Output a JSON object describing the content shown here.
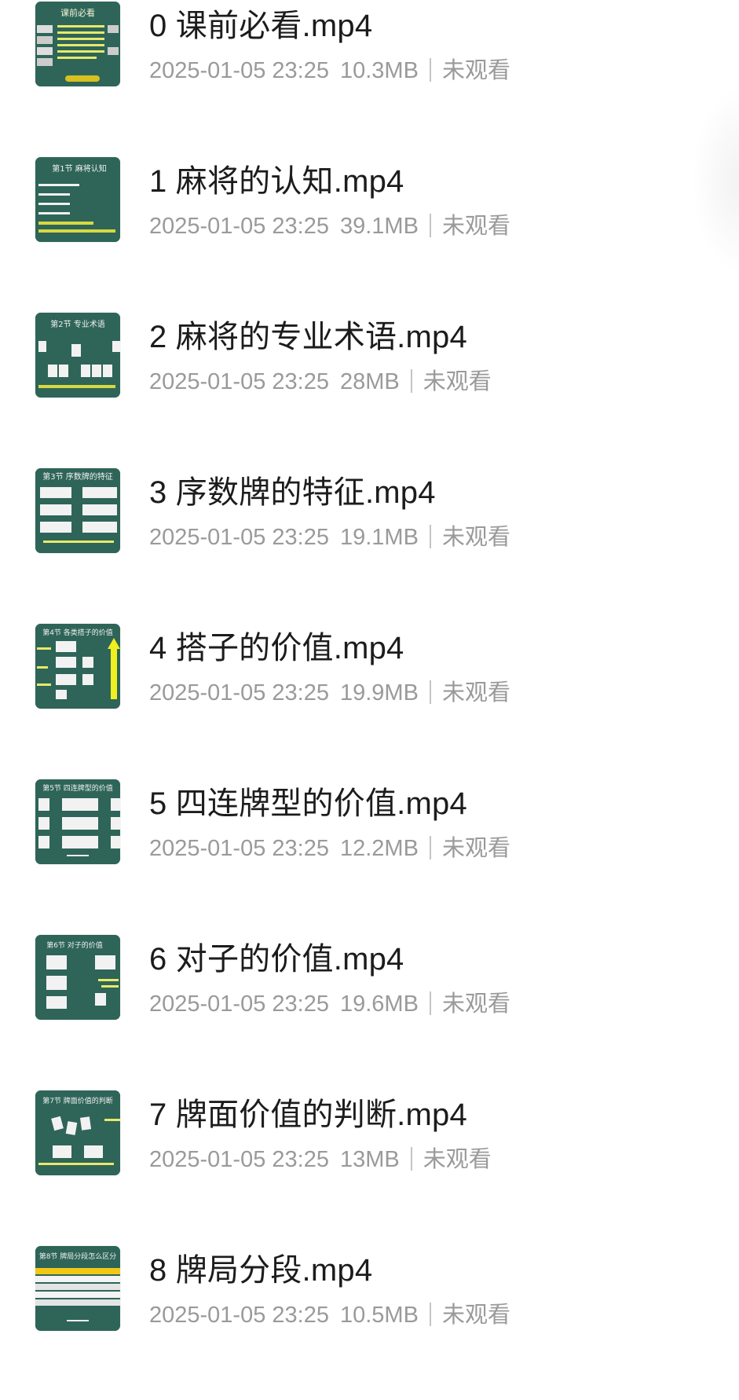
{
  "files": [
    {
      "name": "0 课前必看.mp4",
      "date": "2025-01-05 23:25",
      "size": "10.3MB",
      "status": "未观看",
      "thumb_title": "课前必看"
    },
    {
      "name": "1 麻将的认知.mp4",
      "date": "2025-01-05 23:25",
      "size": "39.1MB",
      "status": "未观看",
      "thumb_title": "第1节 麻将认知"
    },
    {
      "name": "2 麻将的专业术语.mp4",
      "date": "2025-01-05 23:25",
      "size": "28MB",
      "status": "未观看",
      "thumb_title": "第2节 专业术语"
    },
    {
      "name": "3 序数牌的特征.mp4",
      "date": "2025-01-05 23:25",
      "size": "19.1MB",
      "status": "未观看",
      "thumb_title": "第3节 序数牌的特征"
    },
    {
      "name": "4 搭子的价值.mp4",
      "date": "2025-01-05 23:25",
      "size": "19.9MB",
      "status": "未观看",
      "thumb_title": "第4节 各类搭子的价值"
    },
    {
      "name": "5  四连牌型的价值.mp4",
      "date": "2025-01-05 23:25",
      "size": "12.2MB",
      "status": "未观看",
      "thumb_title": "第5节 四连牌型的价值"
    },
    {
      "name": "6 对子的价值.mp4",
      "date": "2025-01-05 23:25",
      "size": "19.6MB",
      "status": "未观看",
      "thumb_title": "第6节 对子的价值"
    },
    {
      "name": "7  牌面价值的判断.mp4",
      "date": "2025-01-05 23:25",
      "size": "13MB",
      "status": "未观看",
      "thumb_title": "第7节 牌面价值的判断"
    },
    {
      "name": "8  牌局分段.mp4",
      "date": "2025-01-05 23:25",
      "size": "10.5MB",
      "status": "未观看",
      "thumb_title": "第8节 牌局分段怎么区分"
    }
  ],
  "colors": {
    "thumb_bg": "#2e6558",
    "title_text": "#1c1c1c",
    "meta_text": "#9a9a9a"
  }
}
